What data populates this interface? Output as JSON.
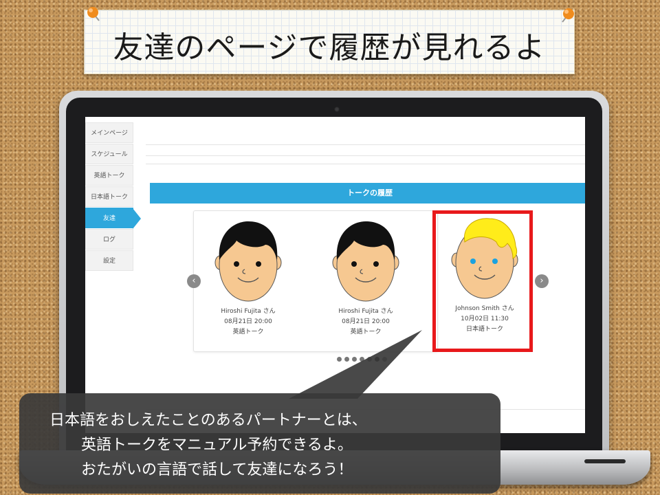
{
  "title": "友達のページで履歴が見れるよ",
  "sidebar": {
    "items": [
      {
        "label": "メインページ"
      },
      {
        "label": "スケジュール"
      },
      {
        "label": "英語トーク"
      },
      {
        "label": "日本語トーク"
      },
      {
        "label": "友達"
      },
      {
        "label": "ログ"
      },
      {
        "label": "設定"
      }
    ],
    "active_index": 4
  },
  "history": {
    "header": "トークの履歴",
    "cards": [
      {
        "name": "Hiroshi Fujita さん",
        "datetime": "08月21日 20:00",
        "type": "英語トーク",
        "avatar": "black-hair-avatar-icon"
      },
      {
        "name": "Hiroshi Fujita さん",
        "datetime": "08月21日 20:00",
        "type": "英語トーク",
        "avatar": "black-hair-avatar-icon"
      },
      {
        "name": "Johnson Smith さん",
        "datetime": "10月02日 11:30",
        "type": "日本語トーク",
        "avatar": "blond-hair-avatar-icon"
      }
    ],
    "prev_icon": "‹",
    "next_icon": "›",
    "dot_count": 7,
    "active_dot": 5
  },
  "bubble": {
    "lines": [
      "日本語をおしえたことのあるパートナーとは、",
      "英語トークをマニュアル予約できるよ。",
      "おたがいの言語で話して友達になろう！"
    ]
  },
  "colors": {
    "accent": "#2ea7dc",
    "highlight": "#e8191b",
    "bubble": "#3a3a3a"
  }
}
